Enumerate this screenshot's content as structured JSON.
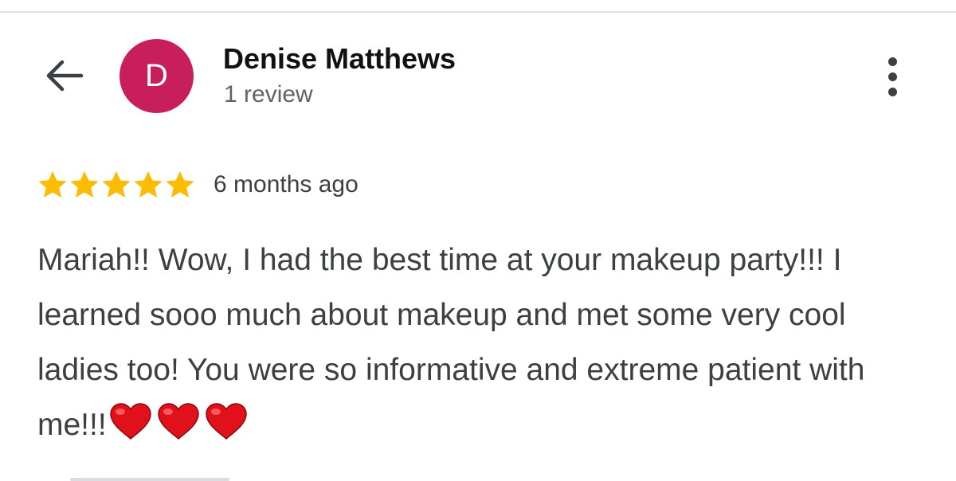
{
  "header": {
    "back_icon": "arrow-back-icon",
    "more_icon": "more-vert-icon"
  },
  "reviewer": {
    "initial": "D",
    "avatar_color": "#c81e5b",
    "name": "Denise Matthews",
    "review_count": "1 review"
  },
  "review": {
    "rating": 5,
    "rating_max": 5,
    "star_color": "#fbbc04",
    "time": "6 months ago",
    "text": "Mariah!! Wow, I had the best time at your makeup party!!! I learned sooo much about makeup and met some very cool ladies too! You were so informative and extreme patient with me!!!",
    "emoji_icon": "red-heart-icon",
    "emoji_count": 3,
    "emoji_color": "#e0111a"
  }
}
